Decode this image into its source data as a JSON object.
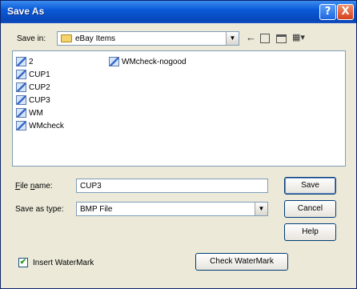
{
  "window": {
    "title": "Save As",
    "help_glyph": "?",
    "close_glyph": "X"
  },
  "toolbar": {
    "save_in_label": "Save in:",
    "save_in_value": "eBay Items",
    "nav_icons": [
      "back-icon",
      "up-folder-icon",
      "new-folder-icon",
      "view-menu-icon"
    ]
  },
  "files": {
    "column1": [
      "2",
      "CUP1",
      "CUP2",
      "CUP3",
      "WM",
      "WMcheck"
    ],
    "column2": [
      "WMcheck-nogood"
    ]
  },
  "form": {
    "file_name_label": "File name:",
    "file_name_value": "CUP3",
    "save_type_label": "Save as type:",
    "save_type_value": "BMP File"
  },
  "buttons": {
    "save": "Save",
    "cancel": "Cancel",
    "help": "Help",
    "check_watermark": "Check WaterMark"
  },
  "watermark": {
    "checkbox_label": "Insert WaterMark",
    "checked": true,
    "check_glyph": "✔"
  }
}
